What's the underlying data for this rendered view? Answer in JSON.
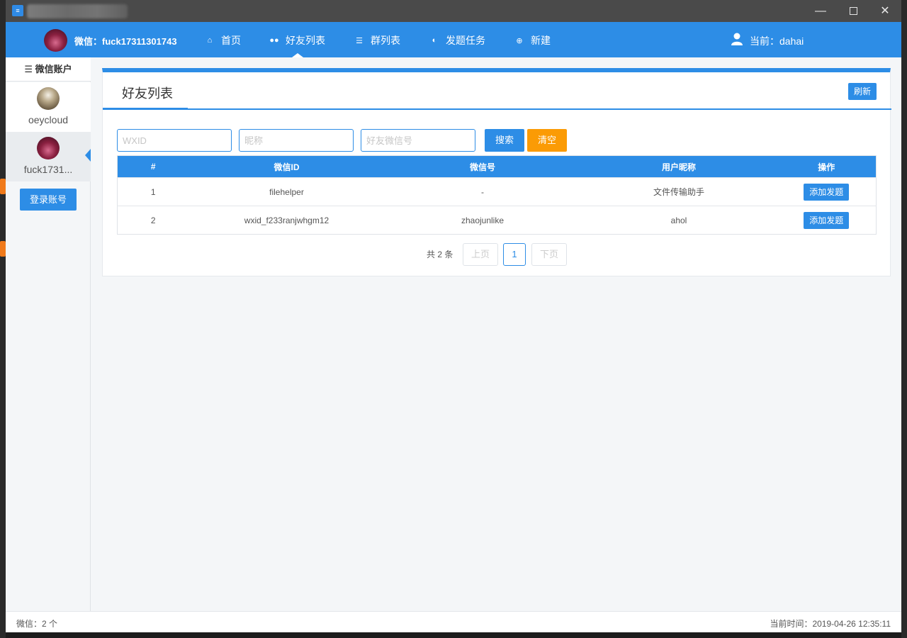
{
  "nav": {
    "wechat_label": "微信：fuck17311301743",
    "items": [
      {
        "label": "首页",
        "icon": "home-icon"
      },
      {
        "label": "好友列表",
        "icon": "users-icon"
      },
      {
        "label": "群列表",
        "icon": "list-icon"
      },
      {
        "label": "发题任务",
        "icon": "task-icon"
      },
      {
        "label": "新建",
        "icon": "plus-circle-icon"
      }
    ],
    "active_index": 1,
    "current_user": "当前：dahai"
  },
  "sidebar": {
    "title": "微信账户",
    "accounts": [
      {
        "name": "oeycloud",
        "selected": false
      },
      {
        "name": "fuck1731...",
        "selected": true
      }
    ],
    "login_button": "登录账号"
  },
  "panel": {
    "title": "好友列表",
    "refresh_label": "刷新",
    "search": {
      "wxid_placeholder": "WXID",
      "nickname_placeholder": "昵称",
      "friend_wechat_placeholder": "好友微信号",
      "search_label": "搜索",
      "clear_label": "清空"
    },
    "table": {
      "headers": [
        "#",
        "微信ID",
        "微信号",
        "用户昵称",
        "操作"
      ],
      "rows": [
        {
          "index": "1",
          "wxid": "filehelper",
          "wechat_no": "-",
          "nickname": "文件传输助手",
          "action": "添加发题"
        },
        {
          "index": "2",
          "wxid": "wxid_f233ranjwhgm12",
          "wechat_no": "zhaojunlike",
          "nickname": "ahol",
          "action": "添加发题"
        }
      ]
    },
    "pager": {
      "total": "共 2 条",
      "prev": "上页",
      "current": "1",
      "next": "下页"
    }
  },
  "status": {
    "left": "微信：2 个",
    "right": "当前时间：2019-04-26 12:35:11"
  },
  "colors": {
    "primary": "#2d8de6",
    "warning": "#fb9b05",
    "titlebar": "#4a4a4a"
  }
}
